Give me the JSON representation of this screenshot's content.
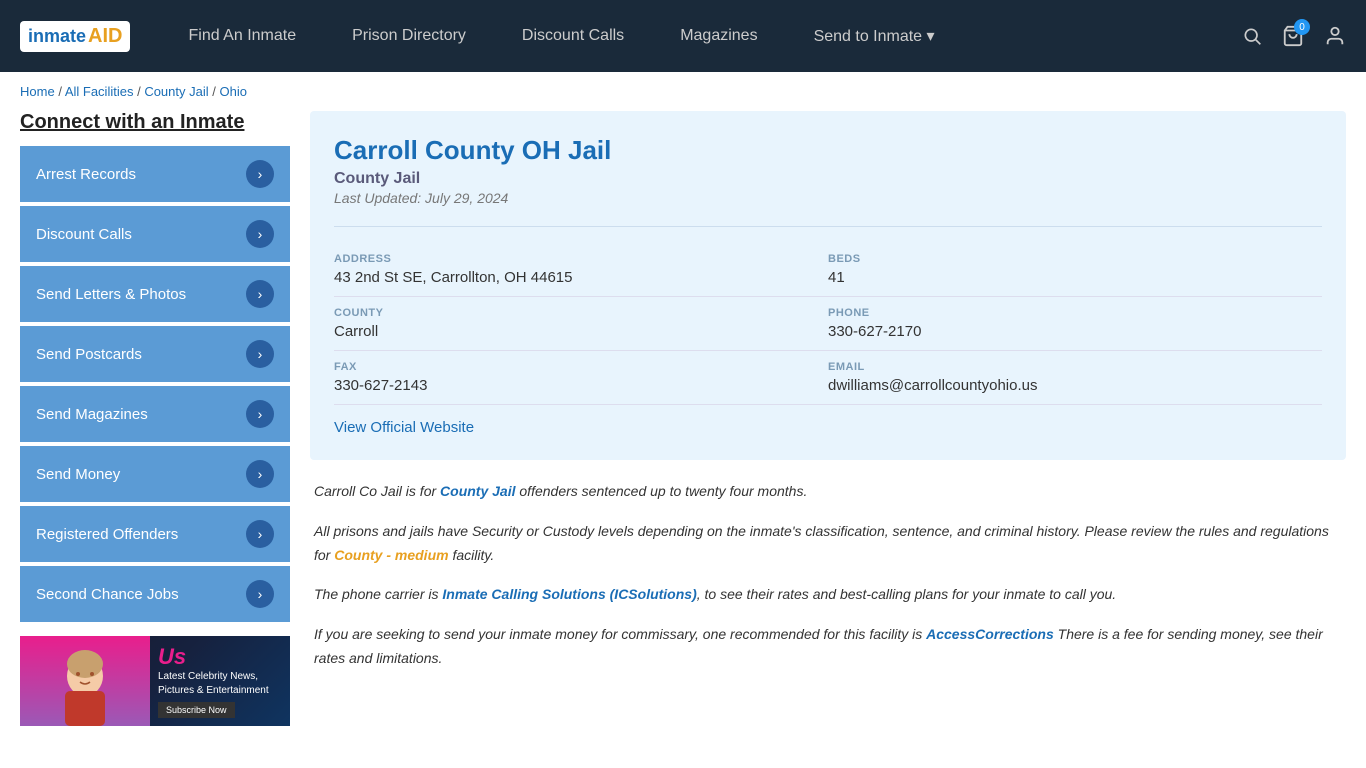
{
  "nav": {
    "logo_inmate": "inmate",
    "logo_aid": "AID",
    "links": [
      {
        "label": "Find An Inmate",
        "id": "find-inmate"
      },
      {
        "label": "Prison Directory",
        "id": "prison-directory"
      },
      {
        "label": "Discount Calls",
        "id": "discount-calls"
      },
      {
        "label": "Magazines",
        "id": "magazines"
      },
      {
        "label": "Send to Inmate ▾",
        "id": "send-to-inmate"
      }
    ],
    "cart_count": "0"
  },
  "breadcrumb": {
    "home": "Home",
    "all_facilities": "All Facilities",
    "county_jail": "County Jail",
    "state": "Ohio"
  },
  "sidebar": {
    "title": "Connect with an Inmate",
    "items": [
      {
        "label": "Arrest Records",
        "id": "arrest-records"
      },
      {
        "label": "Discount Calls",
        "id": "discount-calls"
      },
      {
        "label": "Send Letters & Photos",
        "id": "send-letters"
      },
      {
        "label": "Send Postcards",
        "id": "send-postcards"
      },
      {
        "label": "Send Magazines",
        "id": "send-magazines"
      },
      {
        "label": "Send Money",
        "id": "send-money"
      },
      {
        "label": "Registered Offenders",
        "id": "registered-offenders"
      },
      {
        "label": "Second Chance Jobs",
        "id": "second-chance-jobs"
      }
    ],
    "ad": {
      "tagline": "Latest Celebrity News, Pictures & Entertainment",
      "button": "Subscribe Now"
    }
  },
  "facility": {
    "title": "Carroll County OH Jail",
    "type": "County Jail",
    "last_updated": "Last Updated: July 29, 2024",
    "address_label": "ADDRESS",
    "address_value": "43 2nd St SE, Carrollton, OH 44615",
    "beds_label": "BEDS",
    "beds_value": "41",
    "county_label": "COUNTY",
    "county_value": "Carroll",
    "phone_label": "PHONE",
    "phone_value": "330-627-2170",
    "fax_label": "FAX",
    "fax_value": "330-627-2143",
    "email_label": "EMAIL",
    "email_value": "dwilliams@carrollcountyohio.us",
    "website_link": "View Official Website"
  },
  "description": {
    "p1_before": "Carroll Co Jail is for ",
    "p1_link": "County Jail",
    "p1_after": " offenders sentenced up to twenty four months.",
    "p2_before": "All prisons and jails have Security or Custody levels depending on the inmate's classification, sentence, and criminal history. Please review the rules and regulations for ",
    "p2_link": "County - medium",
    "p2_after": " facility.",
    "p3_before": "The phone carrier is ",
    "p3_link": "Inmate Calling Solutions (ICSolutions)",
    "p3_after": ", to see their rates and best-calling plans for your inmate to call you.",
    "p4_before": "If you are seeking to send your inmate money for commissary, one recommended for this facility is ",
    "p4_link": "AccessCorrections",
    "p4_after": " There is a fee for sending money, see their rates and limitations."
  }
}
